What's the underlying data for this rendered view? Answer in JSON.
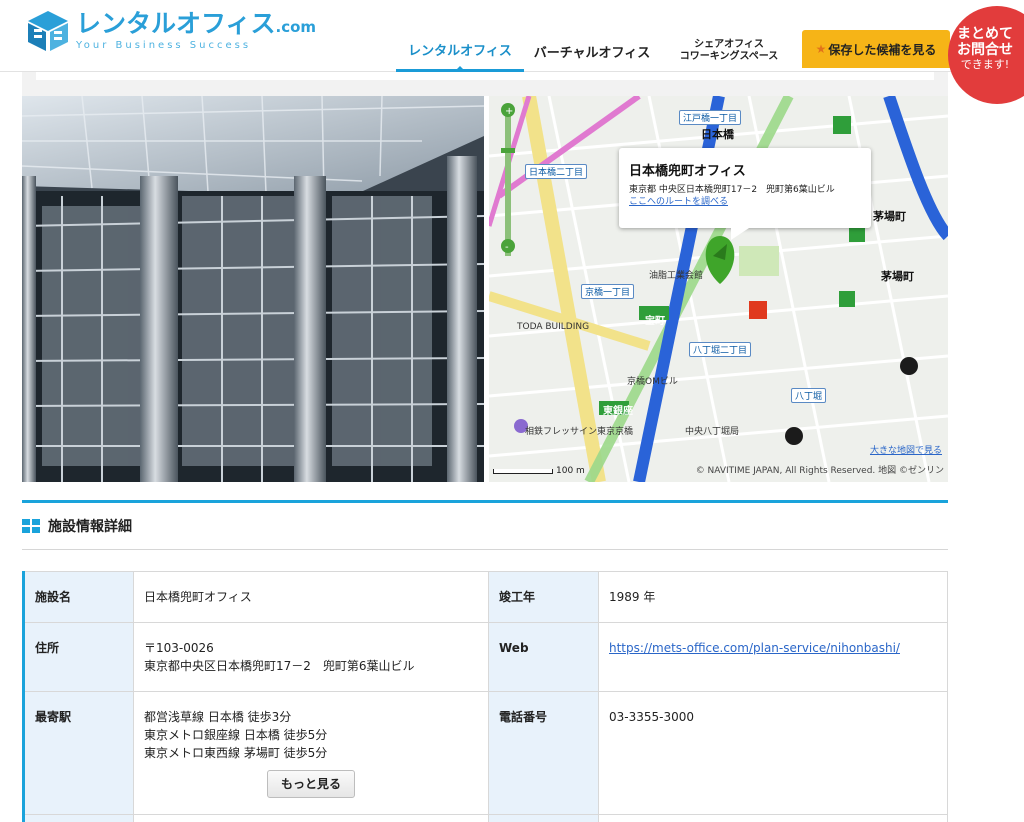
{
  "header": {
    "logo_main": "レンタルオフィス",
    "logo_dotcom": ".com",
    "logo_tagline": "Your Business Success",
    "nav": {
      "rental": "レンタルオフィス",
      "virtual": "バーチャルオフィス",
      "share_line1": "シェアオフィス",
      "share_line2": "コワーキングスペース",
      "saved": "保存した候補を見る"
    },
    "bubble": {
      "line1": "まとめて",
      "line2": "お問合せ",
      "line3": "できます!"
    }
  },
  "map": {
    "popup_title": "日本橋兜町オフィス",
    "popup_address": "東京都 中央区日本橋兜町17－2　兜町第6葉山ビル",
    "popup_route": "ここへのルートを調べる",
    "bigmap_link": "大きな地図で見る",
    "copyright": "© NAVITIME JAPAN, All Rights Reserved. 地図 ©ゼンリン",
    "scale": "100 m",
    "labels": {
      "nihonbashi": "日本橋",
      "edobashi": "江戸橋一丁目",
      "nihonbashi2": "日本橋二丁目",
      "kayabacho": "茅場町",
      "kayabacho2": "茅場町",
      "kyobashi1": "京橋一丁目",
      "hatchobori2": "八丁堀二丁目",
      "hatchobori": "八丁堀",
      "takaracho": "宝町",
      "higashiginza": "東銀座",
      "toda": "TODA BUILDING",
      "yuden": "油脂工業会館",
      "kyobashiom": "京橋OMビル",
      "hachodori": "中央八丁堀局",
      "kyobashi_sun": "相鉄フレッサイン東京京橋"
    }
  },
  "section": {
    "title": "施設情報詳細"
  },
  "table": {
    "facility_label": "施設名",
    "facility_value": "日本橋兜町オフィス",
    "built_label": "竣工年",
    "built_value": "1989 年",
    "address_label": "住所",
    "address_zip": "〒103-0026",
    "address_line": "東京都中央区日本橋兜町17－2　兜町第6葉山ビル",
    "web_label": "Web",
    "web_value": "https://mets-office.com/plan-service/nihonbashi/",
    "station_label": "最寄駅",
    "station1": "都営浅草線 日本橋 徒歩3分",
    "station2": "東京メトロ銀座線 日本橋 徒歩5分",
    "station3": "東京メトロ東西線 茅場町 徒歩5分",
    "more_button": "もっと見る",
    "phone_label": "電話番号",
    "phone_value": "03-3355-3000"
  },
  "colors": {
    "accent": "#1aa3db",
    "saved_button": "#f6b417",
    "bubble": "#e23c3c",
    "table_header_bg": "#e8f2fb"
  },
  "icons": [
    "logo-cube-icon",
    "star-icon",
    "map-pin-icon",
    "zoom-slider-icon",
    "section-grid-icon"
  ]
}
